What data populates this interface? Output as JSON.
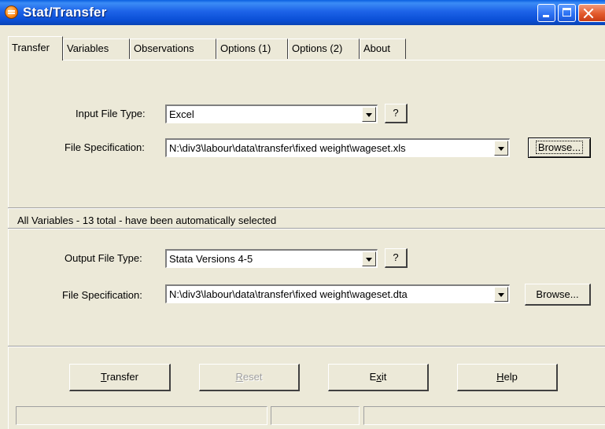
{
  "window": {
    "title": "Stat/Transfer"
  },
  "tabs": [
    "Transfer",
    "Variables",
    "Observations",
    "Options (1)",
    "Options (2)",
    "About"
  ],
  "input": {
    "type_label": "Input File Type:",
    "type_value": "Excel",
    "help_label": "?",
    "spec_label": "File Specification:",
    "spec_value": "N:\\div3\\labour\\data\\transfer\\fixed weight\\wageset.xls",
    "browse_label": "Browse..."
  },
  "status_message": "All Variables - 13 total - have been automatically selected",
  "output": {
    "type_label": "Output File Type:",
    "type_value": "Stata Versions 4-5",
    "help_label": "?",
    "spec_label": "File Specification:",
    "spec_value": "N:\\div3\\labour\\data\\transfer\\fixed weight\\wageset.dta",
    "browse_label": "Browse..."
  },
  "buttons": {
    "transfer": {
      "first": "T",
      "rest": "ransfer"
    },
    "reset": {
      "first": "R",
      "rest": "eset"
    },
    "exit": {
      "pre": "E",
      "mid": "x",
      "post": "it"
    },
    "help": {
      "first": "H",
      "rest": "elp"
    }
  },
  "colors": {
    "titlebar": "#0a4fd6",
    "face": "#ece9d8"
  }
}
